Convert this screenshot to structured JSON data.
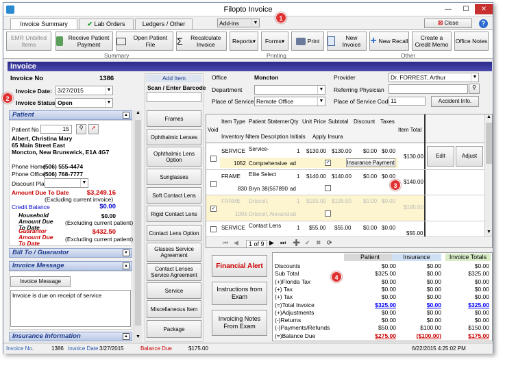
{
  "window": {
    "title": "Filopto Invoice",
    "close_label": "Close",
    "addins_label": "Add-ins"
  },
  "tabs": [
    "Invoice Summary",
    "Lab Orders",
    "Ledgers / Other"
  ],
  "ribbon": {
    "buttons": [
      "EMR Unbilled Items",
      "Receive Patient Payment",
      "Open Patient File",
      "Recalculate Invoice",
      "Reports",
      "Forms",
      "Print",
      "New Invoice",
      "New Recall",
      "Create a Credit Memo",
      "Office Notes"
    ],
    "groups": [
      "Summary",
      "Printing",
      "Other"
    ]
  },
  "section_title": "Invoice",
  "invoice": {
    "no_label": "Invoice No",
    "no": "1386",
    "date_label": "Invoice Date:",
    "date": "3/27/2015",
    "status_label": "Invoice Status",
    "status": "Open"
  },
  "patient": {
    "header": "Patient",
    "no_label": "Patient No",
    "no": "15",
    "name": "Albert, Christina Mary",
    "addr1": "65 Main Street East",
    "addr2": "Moncton, New Brunswick, E1A 4G7",
    "phone_home_label": "Phone Home",
    "phone_home": "(506) 555-4474",
    "phone_office_label": "Phone Office",
    "phone_office": "(506) 768-7777",
    "discount_label": "Discount Plan",
    "amount_due_label": "Amount Due To Date",
    "amount_due": "$3,249.16",
    "excl_invoice": "(Excluding current invoice)",
    "credit_label": "Credit Balance",
    "credit": "$0.00",
    "household_label": "Household Amount Due To Date",
    "household": "$0.00",
    "excl_patient": "(Excluding current patient)",
    "guarantor_label": "Guarantor Amount Due To Date",
    "guarantor": "$432.50",
    "excl_patient2": "(Excluding current patient)"
  },
  "sections": {
    "bill_to": "Bill To / Guarantor",
    "inv_msg": "Invoice Message",
    "inv_msg_btn": "Invoice Message",
    "inv_msg_text": "Invoice is due on receipt of service",
    "insurance": "Insurance Information"
  },
  "items": {
    "add_label": "Add Item",
    "scan_label": "Scan / Enter Barcode",
    "buttons": [
      "Frames",
      "Ophthalmic Lenses",
      "Ophthalmic Lens Option",
      "Sunglasses",
      "Soft Contact Lens",
      "Rigid Contact Lens",
      "Contact Lens Option",
      "Glasses Service Agreement",
      "Contact Lenses Service Agreement",
      "Service",
      "Miscellaneous Item",
      "Package"
    ]
  },
  "office": {
    "office_label": "Office",
    "office": "Moncton",
    "dept_label": "Department",
    "place_label": "Place of Service",
    "place": "Remote Office",
    "provider_label": "Provider",
    "provider": "Dr. FORREST, Arthur",
    "ref_label": "Referring Physician",
    "pos_code_label": "Place of Service Code",
    "pos_code": "11",
    "accident_btn": "Accident Info."
  },
  "grid": {
    "headers": {
      "void": "Void",
      "item_type": "Item Type",
      "inventory": "Inventory N",
      "patient_stmt": "Patient Statemer",
      "item_desc": "Item Description",
      "qty": "Qty",
      "initials": "Initials",
      "unit_price": "Unit Price",
      "apply_ins": "Apply Insura",
      "subtotal": "Subtotal",
      "discount": "Discount",
      "taxes": "Taxes",
      "item_total": "Item Total"
    },
    "rows": [
      {
        "type": "SERVICE",
        "stmt": "Service-",
        "qty": "1",
        "price": "$130.00",
        "sub": "$130.00",
        "disc": "$0.00",
        "tax": "$0.00",
        "inv": "1052",
        "desc": "Comprehensive",
        "init": "ad",
        "ins_btn": "Insurance Payment",
        "total": "$130.00",
        "edit": "Edit",
        "adjust": "Adjust"
      },
      {
        "type": "FRAME",
        "stmt": "Elite Select",
        "qty": "1",
        "price": "$140.00",
        "sub": "$140.00",
        "disc": "$0.00",
        "tax": "$0.00",
        "inv": "830",
        "desc": "Bryn 38(567890",
        "init": "ad",
        "total": "$140.00"
      },
      {
        "type": "FRAME",
        "stmt": "Driscoll,",
        "qty": "1",
        "price": "$195.00",
        "sub": "$195.00",
        "disc": "$0.00",
        "tax": "$0.00",
        "inv": "1005",
        "desc": "Driscoll, Alexand",
        "init": "ad",
        "total": "$195.00"
      },
      {
        "type": "SERVICE",
        "stmt": "Contact Lens",
        "qty": "1",
        "price": "$55.00",
        "sub": "$55.00",
        "disc": "$0.00",
        "tax": "$0.00",
        "total": "$55.00"
      }
    ],
    "nav_page": "1 of 9"
  },
  "actions": {
    "financial_alert": "Financial Alert",
    "instructions": "Instructions from Exam",
    "notes": "Invoicing Notes From Exam"
  },
  "totals": {
    "col_patient": "Patient",
    "col_insurance": "Insurance",
    "col_totals": "Invoice Totals",
    "rows": [
      {
        "label": "Discounts",
        "p": "$0.00",
        "i": "$0.00",
        "t": "$0.00"
      },
      {
        "label": "Sub Total",
        "p": "$325.00",
        "i": "$0.00",
        "t": "$325.00"
      },
      {
        "label": "(+)Florida Tax",
        "p": "$0.00",
        "i": "$0.00",
        "t": "$0.00"
      },
      {
        "label": "(+) Tax",
        "p": "$0.00",
        "i": "$0.00",
        "t": "$0.00"
      },
      {
        "label": "(+) Tax",
        "p": "$0.00",
        "i": "$0.00",
        "t": "$0.00"
      },
      {
        "label": "(=)Total Invoice",
        "p": "$325.00",
        "i": "$0.00",
        "t": "$325.00"
      },
      {
        "label": "(+)Adjustments",
        "p": "$0.00",
        "i": "$0.00",
        "t": "$0.00"
      },
      {
        "label": "(-)Returns",
        "p": "$0.00",
        "i": "$0.00",
        "t": "$0.00"
      },
      {
        "label": "(-)Payments/Refunds",
        "p": "$50.00",
        "i": "$100.00",
        "t": "$150.00"
      },
      {
        "label": "(=)Balance Due",
        "p": "$275.00",
        "i": "($100.00)",
        "t": "$175.00"
      }
    ]
  },
  "status": {
    "inv_no_label": "Invoice No.",
    "inv_no": "1386",
    "inv_date_label": "Invoice Date",
    "inv_date": "3/27/2015",
    "balance_label": "Balance Due",
    "balance": "$175.00",
    "datetime": "6/22/2015 4:25:02 PM"
  },
  "callouts": [
    "1",
    "2",
    "3",
    "4"
  ],
  "colors": {
    "accent": "#2b2b8a",
    "alert": "#cc0000",
    "link": "#0000ff",
    "callout": "#e03030"
  }
}
